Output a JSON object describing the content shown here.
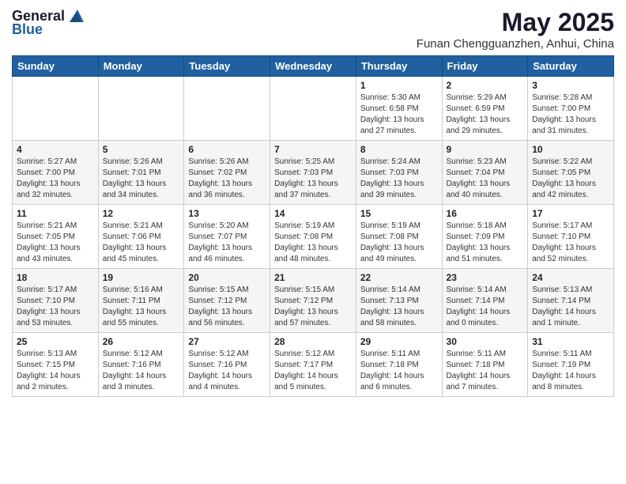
{
  "logo": {
    "general": "General",
    "blue": "Blue"
  },
  "header": {
    "title": "May 2025",
    "subtitle": "Funan Chengguanzhen, Anhui, China"
  },
  "weekdays": [
    "Sunday",
    "Monday",
    "Tuesday",
    "Wednesday",
    "Thursday",
    "Friday",
    "Saturday"
  ],
  "weeks": [
    [
      {
        "day": "",
        "info": ""
      },
      {
        "day": "",
        "info": ""
      },
      {
        "day": "",
        "info": ""
      },
      {
        "day": "",
        "info": ""
      },
      {
        "day": "1",
        "info": "Sunrise: 5:30 AM\nSunset: 6:58 PM\nDaylight: 13 hours\nand 27 minutes."
      },
      {
        "day": "2",
        "info": "Sunrise: 5:29 AM\nSunset: 6:59 PM\nDaylight: 13 hours\nand 29 minutes."
      },
      {
        "day": "3",
        "info": "Sunrise: 5:28 AM\nSunset: 7:00 PM\nDaylight: 13 hours\nand 31 minutes."
      }
    ],
    [
      {
        "day": "4",
        "info": "Sunrise: 5:27 AM\nSunset: 7:00 PM\nDaylight: 13 hours\nand 32 minutes."
      },
      {
        "day": "5",
        "info": "Sunrise: 5:26 AM\nSunset: 7:01 PM\nDaylight: 13 hours\nand 34 minutes."
      },
      {
        "day": "6",
        "info": "Sunrise: 5:26 AM\nSunset: 7:02 PM\nDaylight: 13 hours\nand 36 minutes."
      },
      {
        "day": "7",
        "info": "Sunrise: 5:25 AM\nSunset: 7:03 PM\nDaylight: 13 hours\nand 37 minutes."
      },
      {
        "day": "8",
        "info": "Sunrise: 5:24 AM\nSunset: 7:03 PM\nDaylight: 13 hours\nand 39 minutes."
      },
      {
        "day": "9",
        "info": "Sunrise: 5:23 AM\nSunset: 7:04 PM\nDaylight: 13 hours\nand 40 minutes."
      },
      {
        "day": "10",
        "info": "Sunrise: 5:22 AM\nSunset: 7:05 PM\nDaylight: 13 hours\nand 42 minutes."
      }
    ],
    [
      {
        "day": "11",
        "info": "Sunrise: 5:21 AM\nSunset: 7:05 PM\nDaylight: 13 hours\nand 43 minutes."
      },
      {
        "day": "12",
        "info": "Sunrise: 5:21 AM\nSunset: 7:06 PM\nDaylight: 13 hours\nand 45 minutes."
      },
      {
        "day": "13",
        "info": "Sunrise: 5:20 AM\nSunset: 7:07 PM\nDaylight: 13 hours\nand 46 minutes."
      },
      {
        "day": "14",
        "info": "Sunrise: 5:19 AM\nSunset: 7:08 PM\nDaylight: 13 hours\nand 48 minutes."
      },
      {
        "day": "15",
        "info": "Sunrise: 5:19 AM\nSunset: 7:08 PM\nDaylight: 13 hours\nand 49 minutes."
      },
      {
        "day": "16",
        "info": "Sunrise: 5:18 AM\nSunset: 7:09 PM\nDaylight: 13 hours\nand 51 minutes."
      },
      {
        "day": "17",
        "info": "Sunrise: 5:17 AM\nSunset: 7:10 PM\nDaylight: 13 hours\nand 52 minutes."
      }
    ],
    [
      {
        "day": "18",
        "info": "Sunrise: 5:17 AM\nSunset: 7:10 PM\nDaylight: 13 hours\nand 53 minutes."
      },
      {
        "day": "19",
        "info": "Sunrise: 5:16 AM\nSunset: 7:11 PM\nDaylight: 13 hours\nand 55 minutes."
      },
      {
        "day": "20",
        "info": "Sunrise: 5:15 AM\nSunset: 7:12 PM\nDaylight: 13 hours\nand 56 minutes."
      },
      {
        "day": "21",
        "info": "Sunrise: 5:15 AM\nSunset: 7:12 PM\nDaylight: 13 hours\nand 57 minutes."
      },
      {
        "day": "22",
        "info": "Sunrise: 5:14 AM\nSunset: 7:13 PM\nDaylight: 13 hours\nand 58 minutes."
      },
      {
        "day": "23",
        "info": "Sunrise: 5:14 AM\nSunset: 7:14 PM\nDaylight: 14 hours\nand 0 minutes."
      },
      {
        "day": "24",
        "info": "Sunrise: 5:13 AM\nSunset: 7:14 PM\nDaylight: 14 hours\nand 1 minute."
      }
    ],
    [
      {
        "day": "25",
        "info": "Sunrise: 5:13 AM\nSunset: 7:15 PM\nDaylight: 14 hours\nand 2 minutes."
      },
      {
        "day": "26",
        "info": "Sunrise: 5:12 AM\nSunset: 7:16 PM\nDaylight: 14 hours\nand 3 minutes."
      },
      {
        "day": "27",
        "info": "Sunrise: 5:12 AM\nSunset: 7:16 PM\nDaylight: 14 hours\nand 4 minutes."
      },
      {
        "day": "28",
        "info": "Sunrise: 5:12 AM\nSunset: 7:17 PM\nDaylight: 14 hours\nand 5 minutes."
      },
      {
        "day": "29",
        "info": "Sunrise: 5:11 AM\nSunset: 7:18 PM\nDaylight: 14 hours\nand 6 minutes."
      },
      {
        "day": "30",
        "info": "Sunrise: 5:11 AM\nSunset: 7:18 PM\nDaylight: 14 hours\nand 7 minutes."
      },
      {
        "day": "31",
        "info": "Sunrise: 5:11 AM\nSunset: 7:19 PM\nDaylight: 14 hours\nand 8 minutes."
      }
    ]
  ]
}
